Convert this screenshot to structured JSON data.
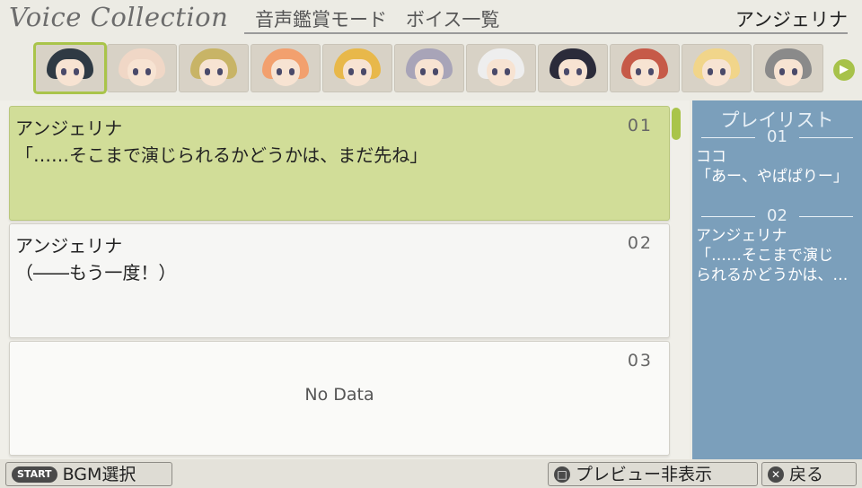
{
  "header": {
    "logo_text": "Voice Collection",
    "mode_title": "音声鑑賞モード　ボイス一覧",
    "current_character": "アンジェリナ"
  },
  "portraits": [
    {
      "name": "angelina-portrait",
      "hair": "#2f3a44",
      "selected": true
    },
    {
      "name": "portrait-2",
      "hair": "#f0d7c6"
    },
    {
      "name": "portrait-3",
      "hair": "#c8b466"
    },
    {
      "name": "portrait-4",
      "hair": "#f2a06e"
    },
    {
      "name": "portrait-5",
      "hair": "#e8b84a"
    },
    {
      "name": "portrait-6",
      "hair": "#a8a4b8"
    },
    {
      "name": "portrait-7",
      "hair": "#eeeeee"
    },
    {
      "name": "portrait-8",
      "hair": "#2b2b3a"
    },
    {
      "name": "portrait-9",
      "hair": "#c65a48"
    },
    {
      "name": "portrait-10",
      "hair": "#f1d58a"
    },
    {
      "name": "portrait-11",
      "hair": "#8a8a8a"
    }
  ],
  "voices": [
    {
      "number": "01",
      "speaker": "アンジェリナ",
      "line": "「……そこまで演じられるかどうかは、まだ先ね」",
      "selected": true
    },
    {
      "number": "02",
      "speaker": "アンジェリナ",
      "line": "（――もう一度！）"
    },
    {
      "number": "03",
      "nodata": "No Data"
    }
  ],
  "playlist": {
    "title": "プレイリスト",
    "entries": [
      {
        "number": "01",
        "speaker": "ココ",
        "line1": "「あー、やぱぱりー」",
        "line2": ""
      },
      {
        "number": "02",
        "speaker": "アンジェリナ",
        "line1": "「……そこまで演じ",
        "line2": "られるかどうかは、…"
      }
    ]
  },
  "footer": {
    "bgm_key": "START",
    "bgm_label": "BGM選択",
    "preview_label": "プレビュー非表示",
    "back_label": "戻る"
  },
  "colors": {
    "accent": "#a9c44a",
    "selected_row": "#d1dd98",
    "playlist_bg": "#7b9fbb"
  }
}
